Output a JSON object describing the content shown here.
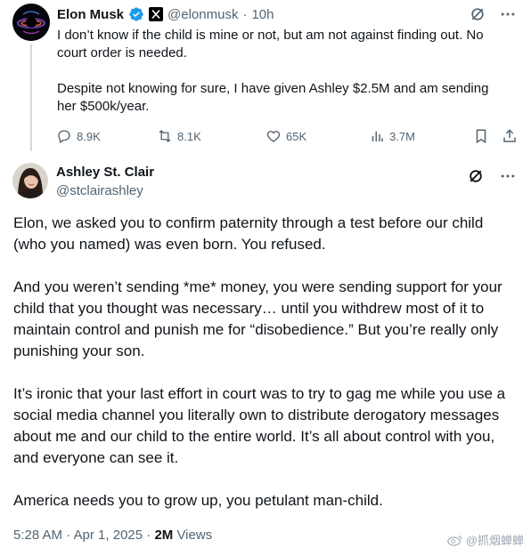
{
  "parent_tweet": {
    "author_name": "Elon Musk",
    "handle": "@elonmusk",
    "separator": "·",
    "time": "10h",
    "paragraphs": [
      "I don’t know if the child is mine or not, but am not against finding out. No court order is needed.",
      "Despite not knowing for sure, I have given Ashley $2.5M and am sending her $500k/year."
    ],
    "stats": {
      "replies": "8.9K",
      "reposts": "8.1K",
      "likes": "65K",
      "views": "3.7M"
    }
  },
  "main_tweet": {
    "author_name": "Ashley St. Clair",
    "handle": "@stclairashley",
    "paragraphs": [
      "Elon, we asked you to confirm paternity through a test before our child (who you named) was even born. You refused.",
      "And you weren’t sending *me* money, you were sending support for your child that you thought was necessary… until you withdrew most of it to maintain control and punish me for “disobedience.” But you’re really only punishing your son.",
      "It’s ironic that your last effort in court was to try to gag me while you use a social media channel you literally own to distribute derogatory messages about me and our child to the entire world. It’s all about control with you, and everyone can see it.",
      "America needs you to grow up, you petulant man-child."
    ],
    "timestamp": "5:28 AM · Apr 1, 2025 · ",
    "views_count": "2M",
    "views_label": " Views"
  },
  "watermark": {
    "text": "@抓烟蝉蝉"
  },
  "colors": {
    "text": "#0f1419",
    "muted": "#536471",
    "verified_blue": "#1d9bf0",
    "line": "#cfd9de"
  }
}
